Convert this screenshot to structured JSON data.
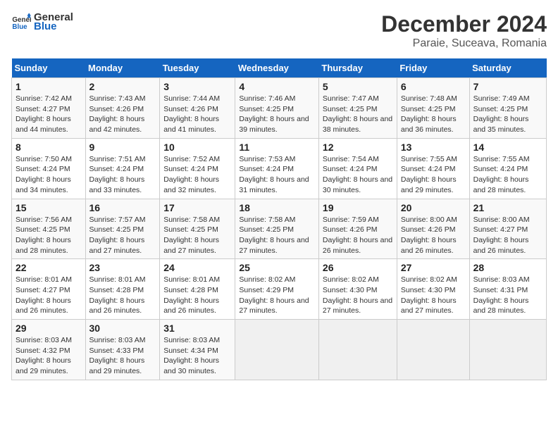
{
  "logo": {
    "text_general": "General",
    "text_blue": "Blue"
  },
  "title": "December 2024",
  "subtitle": "Paraie, Suceava, Romania",
  "header": {
    "accent_color": "#1565c0"
  },
  "days_of_week": [
    "Sunday",
    "Monday",
    "Tuesday",
    "Wednesday",
    "Thursday",
    "Friday",
    "Saturday"
  ],
  "weeks": [
    [
      {
        "day": "1",
        "sunrise": "7:42 AM",
        "sunset": "4:27 PM",
        "daylight": "8 hours and 44 minutes."
      },
      {
        "day": "2",
        "sunrise": "7:43 AM",
        "sunset": "4:26 PM",
        "daylight": "8 hours and 42 minutes."
      },
      {
        "day": "3",
        "sunrise": "7:44 AM",
        "sunset": "4:26 PM",
        "daylight": "8 hours and 41 minutes."
      },
      {
        "day": "4",
        "sunrise": "7:46 AM",
        "sunset": "4:25 PM",
        "daylight": "8 hours and 39 minutes."
      },
      {
        "day": "5",
        "sunrise": "7:47 AM",
        "sunset": "4:25 PM",
        "daylight": "8 hours and 38 minutes."
      },
      {
        "day": "6",
        "sunrise": "7:48 AM",
        "sunset": "4:25 PM",
        "daylight": "8 hours and 36 minutes."
      },
      {
        "day": "7",
        "sunrise": "7:49 AM",
        "sunset": "4:25 PM",
        "daylight": "8 hours and 35 minutes."
      }
    ],
    [
      {
        "day": "8",
        "sunrise": "7:50 AM",
        "sunset": "4:24 PM",
        "daylight": "8 hours and 34 minutes."
      },
      {
        "day": "9",
        "sunrise": "7:51 AM",
        "sunset": "4:24 PM",
        "daylight": "8 hours and 33 minutes."
      },
      {
        "day": "10",
        "sunrise": "7:52 AM",
        "sunset": "4:24 PM",
        "daylight": "8 hours and 32 minutes."
      },
      {
        "day": "11",
        "sunrise": "7:53 AM",
        "sunset": "4:24 PM",
        "daylight": "8 hours and 31 minutes."
      },
      {
        "day": "12",
        "sunrise": "7:54 AM",
        "sunset": "4:24 PM",
        "daylight": "8 hours and 30 minutes."
      },
      {
        "day": "13",
        "sunrise": "7:55 AM",
        "sunset": "4:24 PM",
        "daylight": "8 hours and 29 minutes."
      },
      {
        "day": "14",
        "sunrise": "7:55 AM",
        "sunset": "4:24 PM",
        "daylight": "8 hours and 28 minutes."
      }
    ],
    [
      {
        "day": "15",
        "sunrise": "7:56 AM",
        "sunset": "4:25 PM",
        "daylight": "8 hours and 28 minutes."
      },
      {
        "day": "16",
        "sunrise": "7:57 AM",
        "sunset": "4:25 PM",
        "daylight": "8 hours and 27 minutes."
      },
      {
        "day": "17",
        "sunrise": "7:58 AM",
        "sunset": "4:25 PM",
        "daylight": "8 hours and 27 minutes."
      },
      {
        "day": "18",
        "sunrise": "7:58 AM",
        "sunset": "4:25 PM",
        "daylight": "8 hours and 27 minutes."
      },
      {
        "day": "19",
        "sunrise": "7:59 AM",
        "sunset": "4:26 PM",
        "daylight": "8 hours and 26 minutes."
      },
      {
        "day": "20",
        "sunrise": "8:00 AM",
        "sunset": "4:26 PM",
        "daylight": "8 hours and 26 minutes."
      },
      {
        "day": "21",
        "sunrise": "8:00 AM",
        "sunset": "4:27 PM",
        "daylight": "8 hours and 26 minutes."
      }
    ],
    [
      {
        "day": "22",
        "sunrise": "8:01 AM",
        "sunset": "4:27 PM",
        "daylight": "8 hours and 26 minutes."
      },
      {
        "day": "23",
        "sunrise": "8:01 AM",
        "sunset": "4:28 PM",
        "daylight": "8 hours and 26 minutes."
      },
      {
        "day": "24",
        "sunrise": "8:01 AM",
        "sunset": "4:28 PM",
        "daylight": "8 hours and 26 minutes."
      },
      {
        "day": "25",
        "sunrise": "8:02 AM",
        "sunset": "4:29 PM",
        "daylight": "8 hours and 27 minutes."
      },
      {
        "day": "26",
        "sunrise": "8:02 AM",
        "sunset": "4:30 PM",
        "daylight": "8 hours and 27 minutes."
      },
      {
        "day": "27",
        "sunrise": "8:02 AM",
        "sunset": "4:30 PM",
        "daylight": "8 hours and 27 minutes."
      },
      {
        "day": "28",
        "sunrise": "8:03 AM",
        "sunset": "4:31 PM",
        "daylight": "8 hours and 28 minutes."
      }
    ],
    [
      {
        "day": "29",
        "sunrise": "8:03 AM",
        "sunset": "4:32 PM",
        "daylight": "8 hours and 29 minutes."
      },
      {
        "day": "30",
        "sunrise": "8:03 AM",
        "sunset": "4:33 PM",
        "daylight": "8 hours and 29 minutes."
      },
      {
        "day": "31",
        "sunrise": "8:03 AM",
        "sunset": "4:34 PM",
        "daylight": "8 hours and 30 minutes."
      },
      null,
      null,
      null,
      null
    ]
  ],
  "labels": {
    "sunrise": "Sunrise:",
    "sunset": "Sunset:",
    "daylight": "Daylight:"
  }
}
